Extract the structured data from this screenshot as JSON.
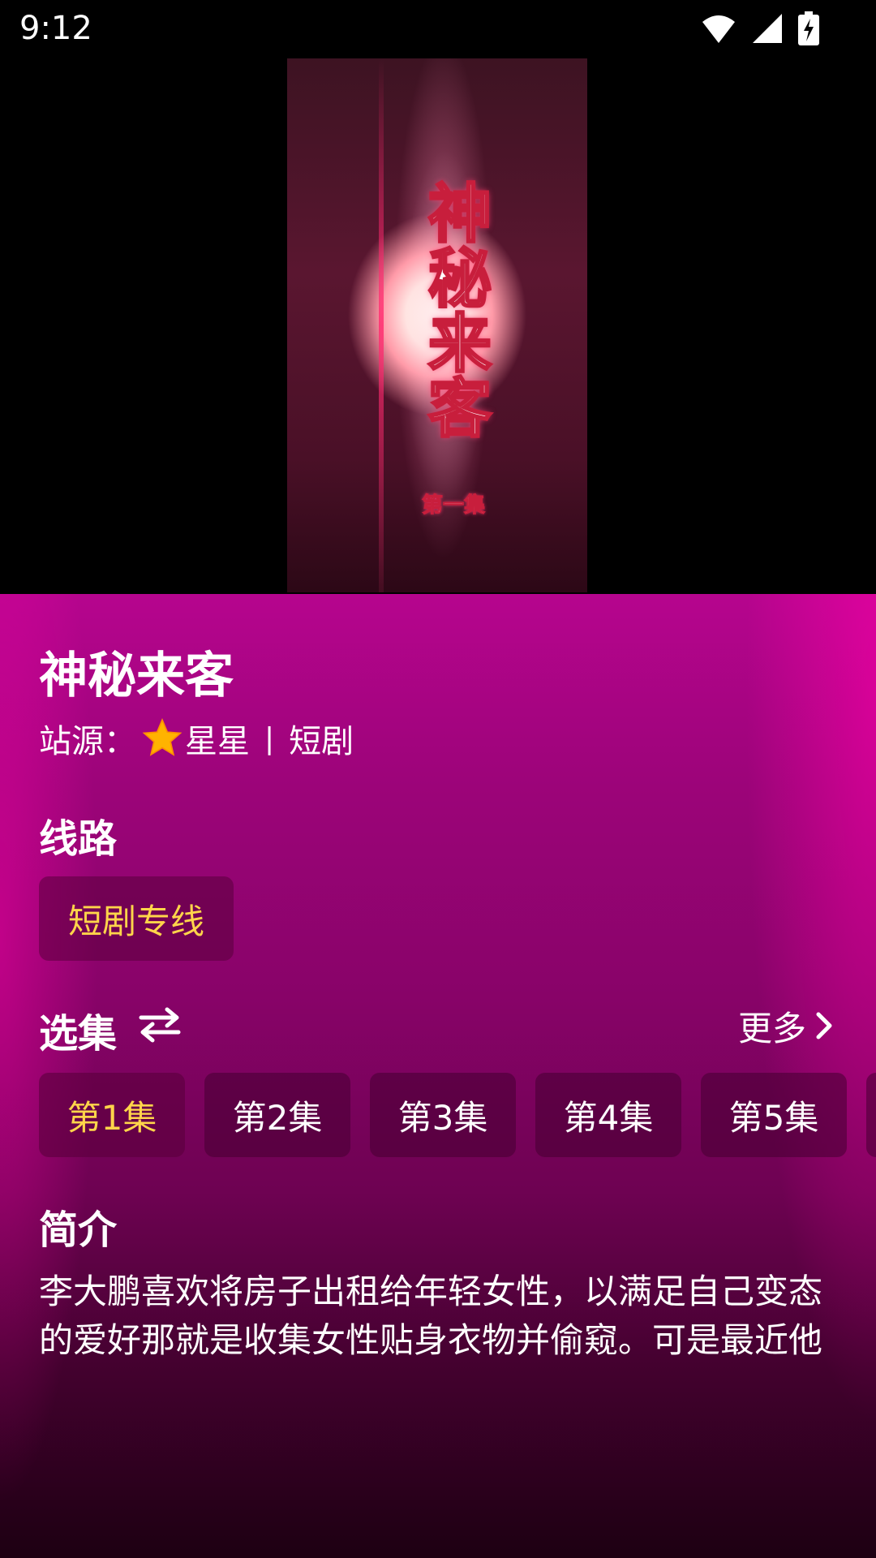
{
  "status_bar": {
    "time": "9:12",
    "icons": [
      "wifi-icon",
      "cellular-signal-icon",
      "battery-charging-icon"
    ]
  },
  "player": {
    "poster_title": "神秘来客",
    "poster_episode": "第一集"
  },
  "details": {
    "title": "神秘来客",
    "source_label": "站源：",
    "source_name": "星星",
    "source_separator": "|",
    "source_type": "短剧"
  },
  "routes": {
    "heading": "线路",
    "items": [
      {
        "label": "短剧专线",
        "selected": true
      }
    ]
  },
  "episodes": {
    "heading": "选集",
    "more_label": "更多",
    "items": [
      {
        "label": "第1集",
        "selected": true
      },
      {
        "label": "第2集",
        "selected": false
      },
      {
        "label": "第3集",
        "selected": false
      },
      {
        "label": "第4集",
        "selected": false
      },
      {
        "label": "第5集",
        "selected": false
      },
      {
        "label": "",
        "selected": false
      }
    ]
  },
  "intro": {
    "heading": "简介",
    "text": "李大鹏喜欢将房子出租给年轻女性，以满足自己变态的爱好那就是收集女性贴身衣物并偷窥。可是最近他"
  },
  "colors": {
    "accent_yellow": "#ffd54a",
    "panel_magenta": "#9c0479",
    "star": "#ffb300"
  }
}
